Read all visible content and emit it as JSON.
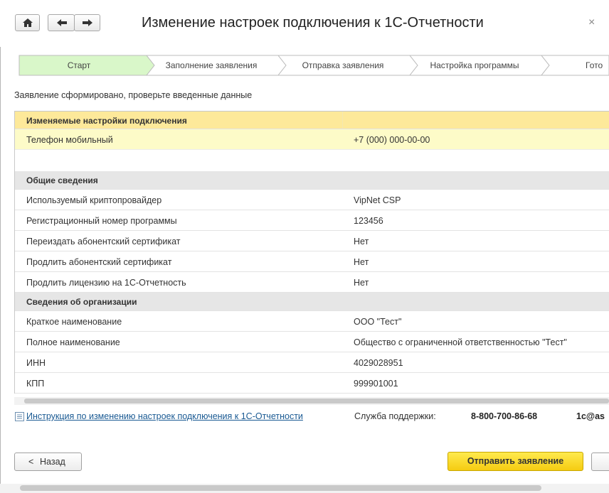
{
  "window": {
    "title": "Изменение настроек подключения к 1С-Отчетности",
    "close_label": "×"
  },
  "steps": [
    {
      "label": "Старт",
      "active": true
    },
    {
      "label": "Заполнение заявления",
      "active": false
    },
    {
      "label": "Отправка заявления",
      "active": false
    },
    {
      "label": "Настройка программы",
      "active": false
    },
    {
      "label": "Гото",
      "active": false
    }
  ],
  "status_text": "Заявление сформировано, проверьте введенные данные",
  "table": {
    "group_changed": "Изменяемые настройки подключения",
    "phone_label": "Телефон мобильный",
    "phone_value": "+7 (000) 000-00-00",
    "group_general": "Общие сведения",
    "general": [
      {
        "label": "Используемый криптопровайдер",
        "value": "VipNet CSP"
      },
      {
        "label": "Регистрационный номер программы",
        "value": "123456"
      },
      {
        "label": "Переиздать абонентский сертификат",
        "value": "Нет"
      },
      {
        "label": "Продлить абонентский сертификат",
        "value": "Нет"
      },
      {
        "label": "Продлить лицензию на 1С-Отчетность",
        "value": "Нет"
      }
    ],
    "group_org": "Сведения об организации",
    "org": [
      {
        "label": "Краткое наименование",
        "value": "ООО \"Тест\""
      },
      {
        "label": "Полное наименование",
        "value": "Общество с ограниченной ответственностью \"Тест\""
      },
      {
        "label": "ИНН",
        "value": "4029028951"
      },
      {
        "label": "КПП",
        "value": "999901001"
      }
    ]
  },
  "footer": {
    "instruction_link": "Инструкция по изменению настроек подключения к 1С-Отчетности",
    "support_label": "Служба поддержки:",
    "support_phone": "8-800-700-86-68",
    "support_email": "1c@as"
  },
  "buttons": {
    "back": "Назад",
    "back_chevron": "<",
    "send": "Отправить заявление"
  },
  "colors": {
    "active_step": "#d9f7c9",
    "send_button": "#f8d51c",
    "group_header_yellow": "#fde99a",
    "selected_row": "#fdfbc8",
    "link": "#1a5a93"
  }
}
